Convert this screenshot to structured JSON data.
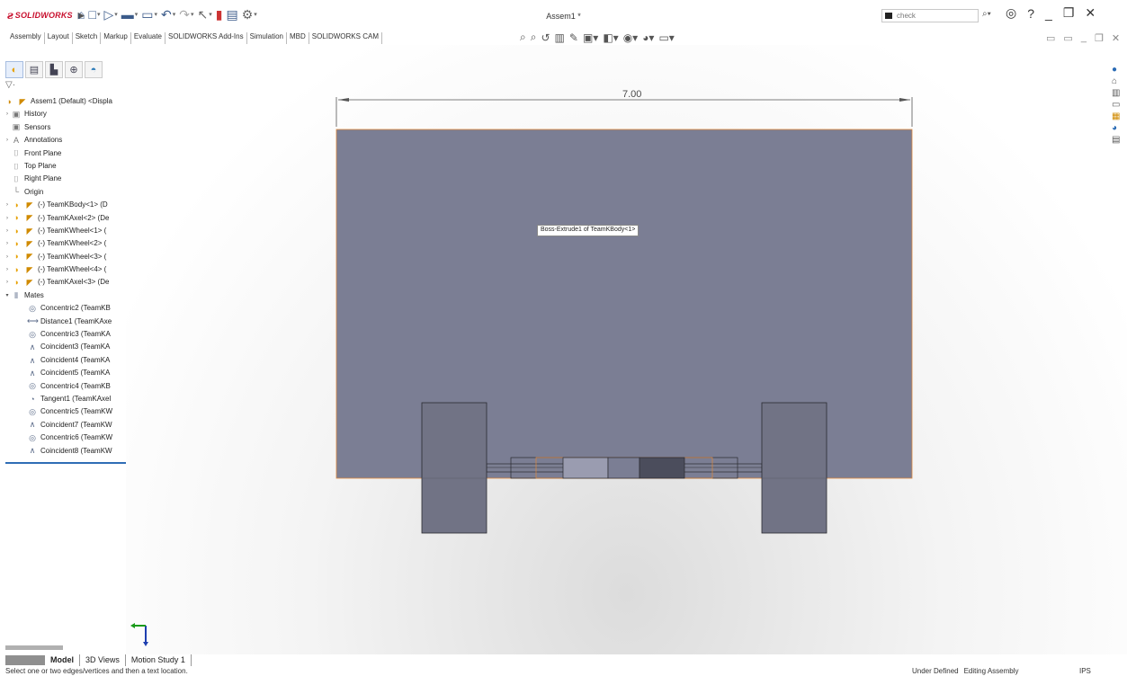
{
  "app": {
    "logo_text": "SOLIDWORKS",
    "document_title": "Assem1 *",
    "search_placeholder": "check"
  },
  "command_tabs": [
    "Assembly",
    "Layout",
    "Sketch",
    "Markup",
    "Evaluate",
    "SOLIDWORKS Add-Ins",
    "Simulation",
    "MBD",
    "SOLIDWORKS CAM"
  ],
  "feature_tree": {
    "root": "Assem1 (Default) <Displa",
    "items": [
      {
        "label": "History",
        "icon": "history-icon",
        "expandable": true
      },
      {
        "label": "Sensors",
        "icon": "sensors-icon",
        "expandable": false
      },
      {
        "label": "Annotations",
        "icon": "annotations-icon",
        "expandable": true
      },
      {
        "label": "Front Plane",
        "icon": "plane-icon",
        "expandable": false
      },
      {
        "label": "Top Plane",
        "icon": "plane-icon",
        "expandable": false
      },
      {
        "label": "Right Plane",
        "icon": "plane-icon",
        "expandable": false
      },
      {
        "label": "Origin",
        "icon": "origin-icon",
        "expandable": false
      },
      {
        "label": "(-) TeamKBody<1> (D",
        "icon": "component-icon",
        "expandable": true
      },
      {
        "label": "(-) TeamKAxel<2> (De",
        "icon": "component-icon",
        "expandable": true
      },
      {
        "label": "(-) TeamKWheel<1> (",
        "icon": "component-icon",
        "expandable": true
      },
      {
        "label": "(-) TeamKWheel<2> (",
        "icon": "component-icon",
        "expandable": true
      },
      {
        "label": "(-) TeamKWheel<3> (",
        "icon": "component-icon",
        "expandable": true
      },
      {
        "label": "(-) TeamKWheel<4> (",
        "icon": "component-icon",
        "expandable": true
      },
      {
        "label": "(-) TeamKAxel<3> (De",
        "icon": "component-icon",
        "expandable": true
      },
      {
        "label": "Mates",
        "icon": "mates-icon",
        "expandable": true,
        "expanded": true
      }
    ],
    "mates": [
      {
        "label": "Concentric2 (TeamKB",
        "icon": "concentric-icon"
      },
      {
        "label": "Distance1 (TeamKAxe",
        "icon": "distance-icon"
      },
      {
        "label": "Concentric3 (TeamKA",
        "icon": "concentric-icon"
      },
      {
        "label": "Coincident3 (TeamKA",
        "icon": "coincident-icon"
      },
      {
        "label": "Coincident4 (TeamKA",
        "icon": "coincident-icon"
      },
      {
        "label": "Coincident5 (TeamKA",
        "icon": "coincident-icon"
      },
      {
        "label": "Concentric4 (TeamKB",
        "icon": "concentric-icon"
      },
      {
        "label": "Tangent1 (TeamKAxel",
        "icon": "tangent-icon"
      },
      {
        "label": "Concentric5 (TeamKW",
        "icon": "concentric-icon"
      },
      {
        "label": "Coincident7 (TeamKW",
        "icon": "coincident-icon"
      },
      {
        "label": "Concentric6 (TeamKW",
        "icon": "concentric-icon"
      },
      {
        "label": "Coincident8 (TeamKW",
        "icon": "coincident-icon"
      }
    ]
  },
  "viewport": {
    "dimension_value": "7.00",
    "tooltip": "Boss-Extrude1 of TeamKBody<1>"
  },
  "bottom_tabs": [
    "Model",
    "3D Views",
    "Motion Study 1"
  ],
  "status": {
    "message": "Select one or two edges/vertices and then a text location.",
    "state": "Under Defined",
    "mode": "Editing Assembly",
    "units": "IPS"
  },
  "colors": {
    "body": "#7b7e94",
    "wheel": "#717385",
    "edge": "#e08a3c",
    "selection_blue": "#2f6db5",
    "brand_red": "#c8102e"
  }
}
